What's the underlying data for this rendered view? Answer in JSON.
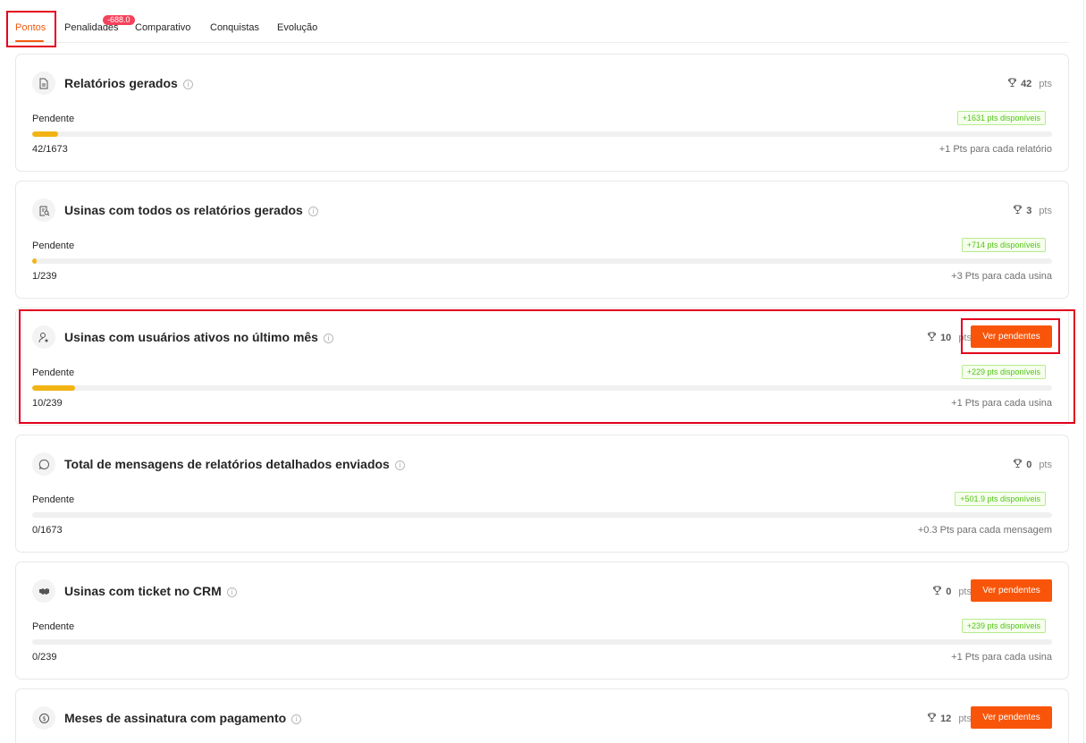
{
  "tabs": [
    {
      "label": "Pontos"
    },
    {
      "label": "Penalidades",
      "badge": "-688.0"
    },
    {
      "label": "Comparativo"
    },
    {
      "label": "Conquistas"
    },
    {
      "label": "Evolução"
    }
  ],
  "pts_unit": "pts",
  "status_label": "Pendente",
  "button_label": "Ver pendentes",
  "accent_color": "#f8550a",
  "progress_color": "#f2b414",
  "cards": [
    {
      "title": "Relatórios gerados",
      "icon": "document-icon",
      "points": "42",
      "available": "+1631 pts disponíveis",
      "progress": 0.025,
      "count": "42/1673",
      "rule": "+1 Pts para cada relatório"
    },
    {
      "title": "Usinas com todos os relatórios gerados",
      "icon": "clipboard-search-icon",
      "points": "3",
      "available": "+714 pts disponíveis",
      "progress": 0.004,
      "count": "1/239",
      "rule": "+3 Pts para cada usina"
    },
    {
      "title": "Usinas com usuários ativos no último mês",
      "icon": "user-active-icon",
      "points": "10",
      "available": "+229 pts disponíveis",
      "progress": 0.042,
      "count": "10/239",
      "rule": "+1 Pts para cada usina"
    },
    {
      "title": "Total de mensagens de relatórios detalhados enviados",
      "icon": "message-icon",
      "points": "0",
      "available": "+501.9 pts disponíveis",
      "progress": 0,
      "count": "0/1673",
      "rule": "+0.3 Pts para cada mensagem"
    },
    {
      "title": "Usinas com ticket no CRM",
      "icon": "handshake-icon",
      "points": "0",
      "available": "+239 pts disponíveis",
      "progress": 0,
      "count": "0/239",
      "rule": "+1 Pts para cada usina"
    },
    {
      "title": "Meses de assinatura com pagamento",
      "icon": "dollar-icon",
      "points": "12",
      "available": "",
      "progress": 0,
      "count": "",
      "rule": ""
    }
  ]
}
